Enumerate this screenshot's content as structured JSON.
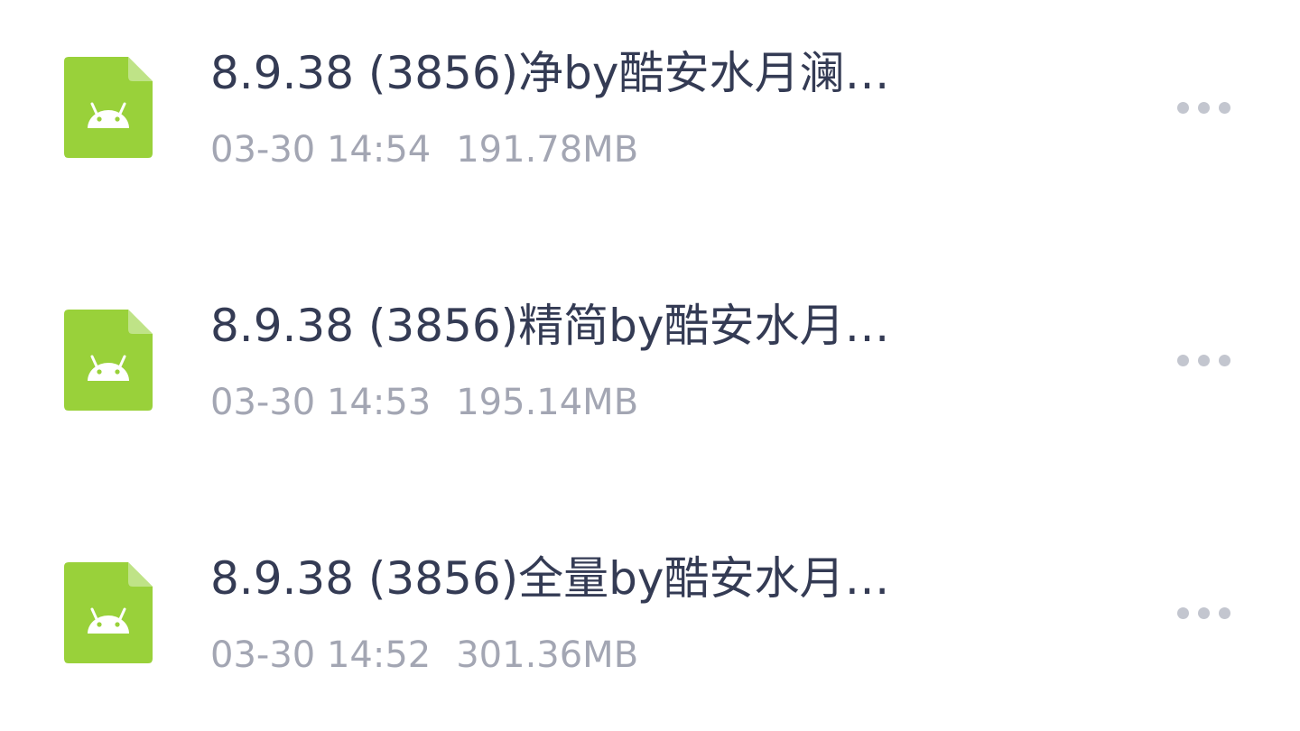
{
  "colors": {
    "icon_bg": "#99d13a",
    "icon_fold": "#bfe387",
    "title_text": "#343b54",
    "meta_text": "#a3a6b3",
    "dots": "#c3c6cf"
  },
  "files": [
    {
      "name": "8.9.38 (3856)净by酷安水月澜…",
      "date": "03-30 14:54",
      "size": "191.78MB",
      "icon": "android-apk-file-icon"
    },
    {
      "name": "8.9.38 (3856)精简by酷安水月…",
      "date": "03-30 14:53",
      "size": "195.14MB",
      "icon": "android-apk-file-icon"
    },
    {
      "name": "8.9.38 (3856)全量by酷安水月…",
      "date": "03-30 14:52",
      "size": "301.36MB",
      "icon": "android-apk-file-icon"
    }
  ],
  "more_icon": "more-horizontal-icon"
}
